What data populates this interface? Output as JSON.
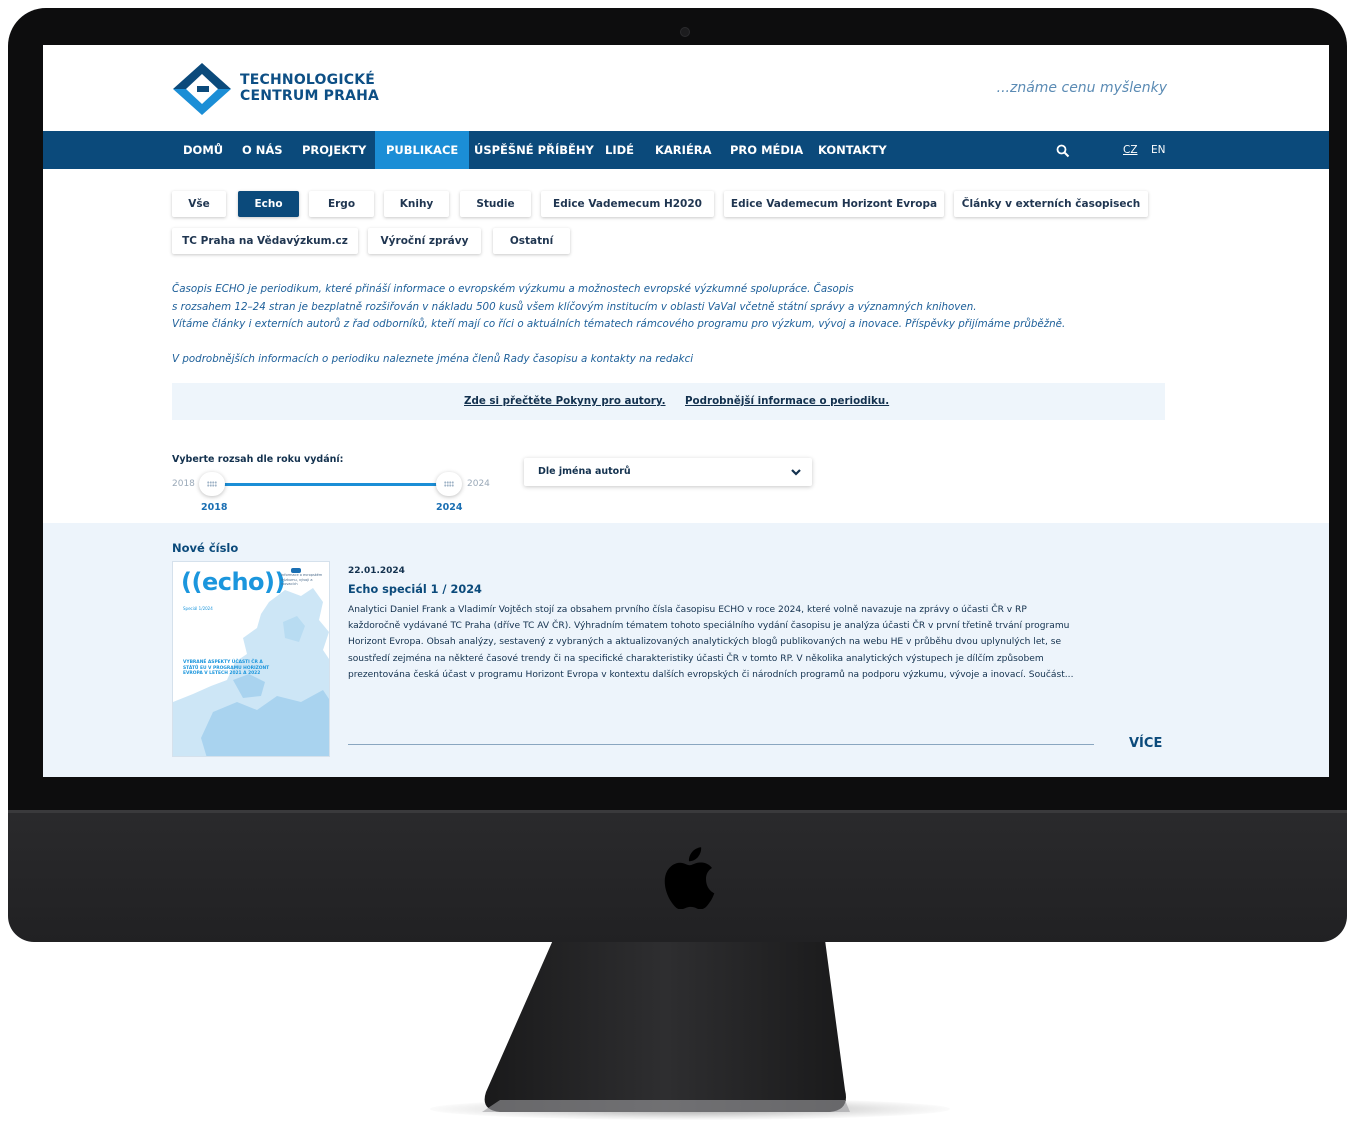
{
  "brand": {
    "name_line1": "TECHNOLOGICKÉ",
    "name_line2": "CENTRUM PRAHA",
    "tagline": "...známe cenu myšlenky",
    "primary_color": "#0b4a7b",
    "accent_color": "#1b8ed6"
  },
  "nav": {
    "items": [
      "DOMŮ",
      "O NÁS",
      "PROJEKTY",
      "PUBLIKACE",
      "ÚSPĚŠNÉ PŘÍBĚHY",
      "LIDÉ",
      "KARIÉRA",
      "PRO MÉDIA",
      "KONTAKTY"
    ],
    "active": "PUBLIKACE",
    "search_icon": "search-icon",
    "lang_cz": "CZ",
    "lang_en": "EN"
  },
  "filters": {
    "row1": [
      "Vše",
      "Echo",
      "Ergo",
      "Knihy",
      "Studie",
      "Edice Vademecum H2020",
      "Edice Vademecum Horizont Evropa",
      "Články v externích časopisech"
    ],
    "row2": [
      "TC Praha na Vědavýzkum.cz",
      "Výroční zprávy",
      "Ostatní"
    ],
    "active": "Echo"
  },
  "intro": {
    "line1": "Časopis ECHO je periodikum, které přináší informace o evropském výzkumu a možnostech evropské výzkumné spolupráce. Časopis",
    "line2": "s rozsahem 12–24 stran je bezplatně rozšiřován v nákladu 500 kusů všem klíčovým institucím v oblasti VaVaI včetně státní správy a významných knihoven.",
    "line3": "Vítáme články i externích autorů z řad odborníků, kteří mají co říci o aktuálních tématech rámcového programu pro výzkum, vývoj a inovace. Příspěvky přijímáme průběžně.",
    "line4": "V podrobnějších informacích o periodiku naleznete jména členů Rady časopisu a kontakty na redakci"
  },
  "links": {
    "authors": "Zde si přečtěte Pokyny pro autory.",
    "details": "Podrobnější informace o periodiku."
  },
  "range": {
    "label": "Vyberte rozsah dle roku vydání:",
    "min_end": "2018",
    "max_end": "2024",
    "from": "2018",
    "to": "2024"
  },
  "author_select": {
    "selected": "Dle jména autorů",
    "icon": "chevron-down-icon"
  },
  "new_issue": {
    "section_title": "Nové číslo",
    "date": "22.01.2024",
    "title": "Echo speciál 1 / 2024",
    "text_lines": [
      "Analytici Daniel Frank a Vladimír Vojtěch stojí za obsahem prvního čísla časopisu ECHO v roce 2024, které volně navazuje na zprávy o účasti ČR v RP",
      "každoročně vydávané TC Praha (dříve TC AV ČR). Výhradním tématem tohoto speciálního vydání časopisu je analýza účasti ČR v první třetině trvání programu",
      "Horizont Evropa. Obsah analýzy, sestavený z vybraných a aktualizovaných analytických blogů publikovaných na webu HE v průběhu dvou uplynulých let, se",
      "soustředí zejména na některé časové trendy či na specifické charakteristiky účasti ČR v tomto RP. V několika analytických výstupech je dílčím způsobem",
      "prezentována česká účast v programu Horizont Evropa v kontextu dalších evropských či národních programů na podporu výzkumu, vývoje a inovací. Součást..."
    ],
    "more": "VÍCE",
    "cover": {
      "word": "((echo))",
      "sub": "Speciál 1/2024",
      "note": "Informace o evropském výzkumu, vývoji a inovacích",
      "heading": "VYBRANÉ ASPEKTY ÚČASTI ČR A STÁTŮ EU V PROGRAMU HORIZONT EVROPA V LETECH 2021 A 2022"
    }
  }
}
